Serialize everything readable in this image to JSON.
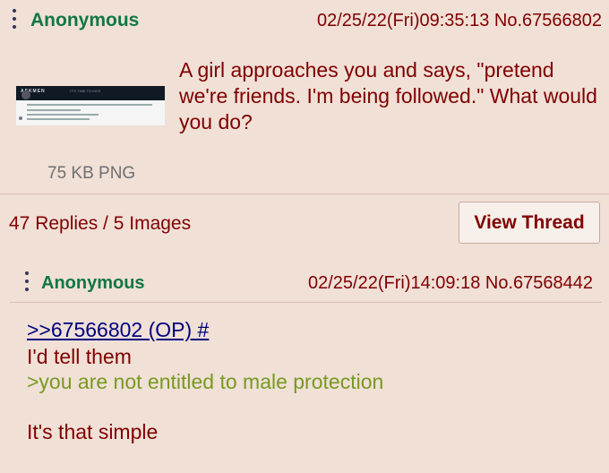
{
  "op": {
    "name": "Anonymous",
    "datetime": "02/25/22(Fri)09:35:13 No.67566802",
    "text": "A girl approaches you and says, \"pretend we're friends. I'm being followed.\" What would you do?",
    "thumbnail_title": "ASKMEN",
    "thumbnail_subtitle": "IT'S TIME TO KISS",
    "file_info": "75 KB PNG",
    "replies_summary": "47 Replies / 5 Images",
    "view_thread_label": "View Thread"
  },
  "reply": {
    "name": "Anonymous",
    "datetime": "02/25/22(Fri)14:09:18 No.67568442",
    "quote_link": ">>67566802 (OP) #",
    "line1": "I'd tell them",
    "greentext": ">you are not entitled to male protection",
    "line3": "It's that simple"
  },
  "colors": {
    "background": "#f0e0d6",
    "name": "#117743",
    "text": "#800000",
    "quote_link": "#000080",
    "greentext": "#789922",
    "file_info": "#707070"
  },
  "icons": {
    "menu": "vertical-dots-menu-icon"
  }
}
